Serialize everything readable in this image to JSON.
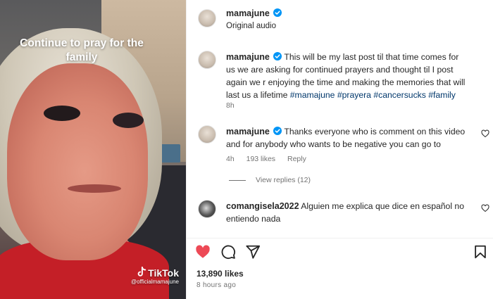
{
  "media": {
    "caption": "Continue to pray for the family",
    "watermark_logo": "TikTok",
    "watermark_handle": "@officialmamajune"
  },
  "header": {
    "username": "mamajune",
    "audio": "Original audio",
    "verified_icon": "verified-badge-icon"
  },
  "comments": [
    {
      "username": "mamajune",
      "text": "This will be my last post til that time comes for us we are asking for continued prayers and thought til I post again we r enjoying the time and making the memories that will last us a lifetime",
      "tags": "#mamajune #prayera #cancersucks #family",
      "time": "8h"
    },
    {
      "username": "mamajune",
      "text": "Thanks everyone who is comment on this video and for anybody who wants to be negative you can go to",
      "time": "4h",
      "likes": "193 likes",
      "reply": "Reply"
    },
    {
      "username": "comangisela2022",
      "text": "Alguien me explica que dice en español no entiendo nada"
    }
  ],
  "view_replies": "View replies (12)",
  "post": {
    "likes": "13,890 likes",
    "posted": "8 hours ago"
  },
  "colors": {
    "like_red": "#ed4956",
    "verified_blue": "#0095f6",
    "link_blue": "#00376b"
  }
}
